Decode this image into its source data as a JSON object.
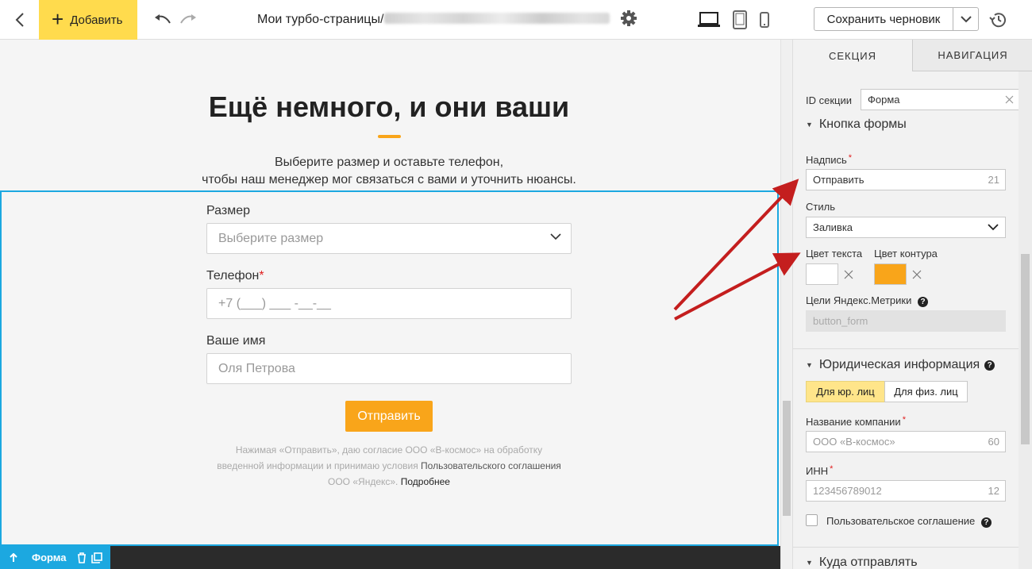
{
  "toolbar": {
    "add_label": "Добавить",
    "path_prefix": "Мои турбо-страницы/",
    "save_draft_label": "Сохранить черновик"
  },
  "canvas": {
    "title": "Ещё немного, и они ваши",
    "subtitle_line1": "Выберите размер и оставьте телефон,",
    "subtitle_line2": "чтобы наш менеджер мог связаться с вами и уточнить нюансы.",
    "form": {
      "size_label": "Размер",
      "size_placeholder": "Выберите размер",
      "phone_label": "Телефон",
      "phone_placeholder": "+7 (___) ___ -__-__",
      "name_label": "Ваше имя",
      "name_placeholder": "Оля Петрова",
      "submit_label": "Отправить"
    },
    "consent": {
      "part1": "Нажимая «Отправить», даю согласие ООО «В-космос» на обработку введенной информации и принимаю условия ",
      "link1": "Пользовательского соглашения",
      "part2": " ООО «Яндекс». ",
      "link2": "Подробнее"
    },
    "selection_badge": "Форма",
    "accent_color": "#f9a51a",
    "selection_color": "#1ca8e0"
  },
  "panel": {
    "tabs": [
      "СЕКЦИЯ",
      "НАВИГАЦИЯ"
    ],
    "section_id_label": "ID секции",
    "section_id_value": "Форма",
    "button_group": {
      "title": "Кнопка формы",
      "caption_label": "Надпись",
      "caption_value": "Отправить",
      "caption_count": "21",
      "style_label": "Стиль",
      "style_value": "Заливка",
      "text_color_label": "Цвет текста",
      "outline_color_label": "Цвет контура",
      "text_color": "#ffffff",
      "outline_color": "#f9a51a",
      "metrika_label": "Цели Яндекс.Метрики",
      "metrika_value": "button_form"
    },
    "legal_group": {
      "title": "Юридическая информация",
      "btn_legal": "Для юр. лиц",
      "btn_person": "Для физ. лиц",
      "company_label": "Название компании",
      "company_placeholder": "ООО «В-космос»",
      "company_count": "60",
      "inn_label": "ИНН",
      "inn_placeholder": "123456789012",
      "inn_count": "12",
      "agreement_label": "Пользовательское соглашение"
    },
    "send_group": {
      "title": "Куда отправлять"
    }
  }
}
